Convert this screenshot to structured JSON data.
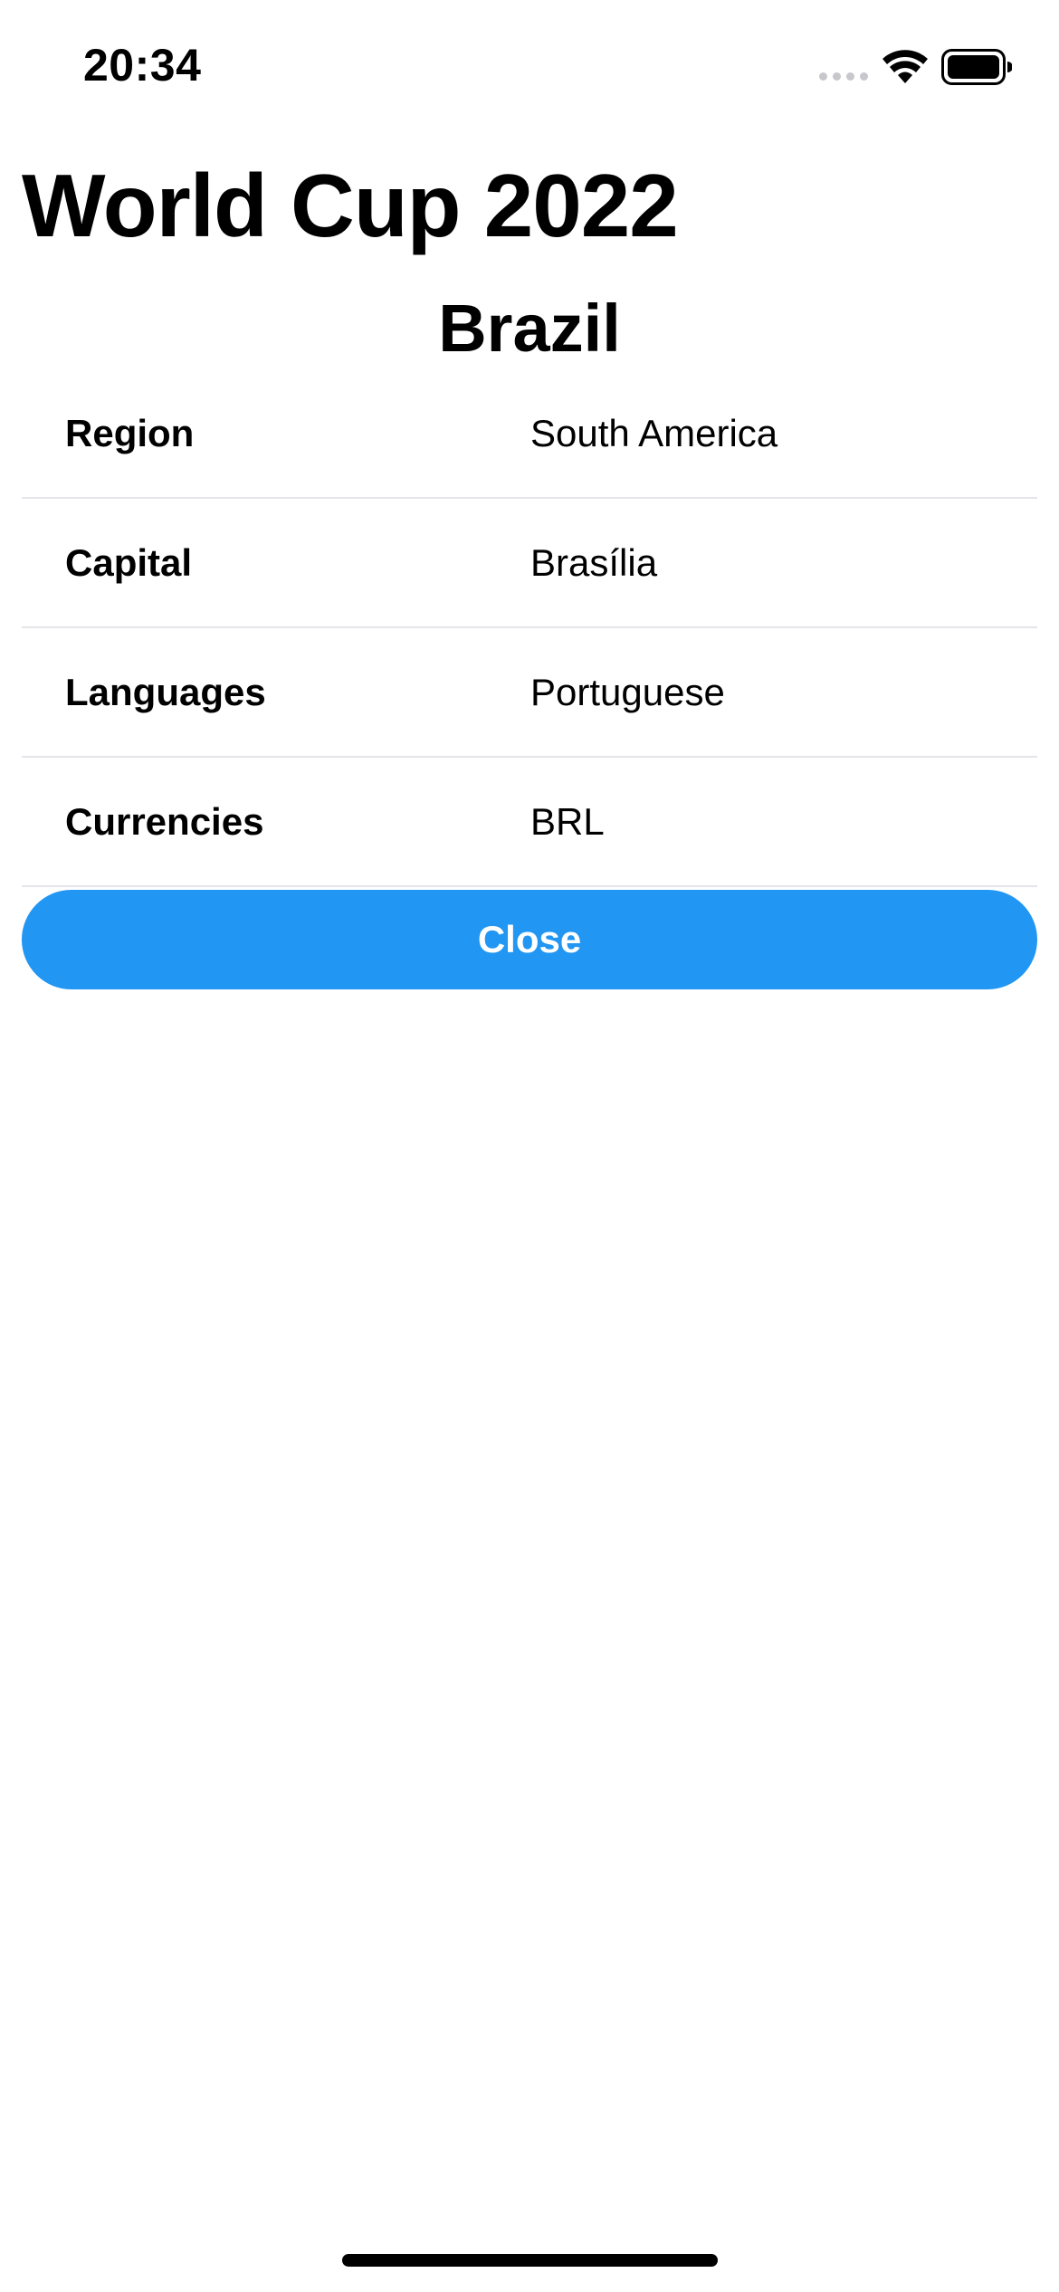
{
  "status_bar": {
    "time": "20:34",
    "signal_icon": "cellular-signal-icon",
    "wifi_icon": "wifi-icon",
    "battery_icon": "battery-icon"
  },
  "header": {
    "title": "World Cup 2022"
  },
  "country": {
    "name": "Brazil",
    "details": [
      {
        "label": "Region",
        "value": "South America"
      },
      {
        "label": "Capital",
        "value": "Brasília"
      },
      {
        "label": "Languages",
        "value": "Portuguese"
      },
      {
        "label": "Currencies",
        "value": "BRL"
      }
    ]
  },
  "actions": {
    "close_label": "Close"
  },
  "colors": {
    "accent": "#2196f3",
    "separator": "#e5e5ea",
    "text": "#000000",
    "background": "#ffffff"
  }
}
